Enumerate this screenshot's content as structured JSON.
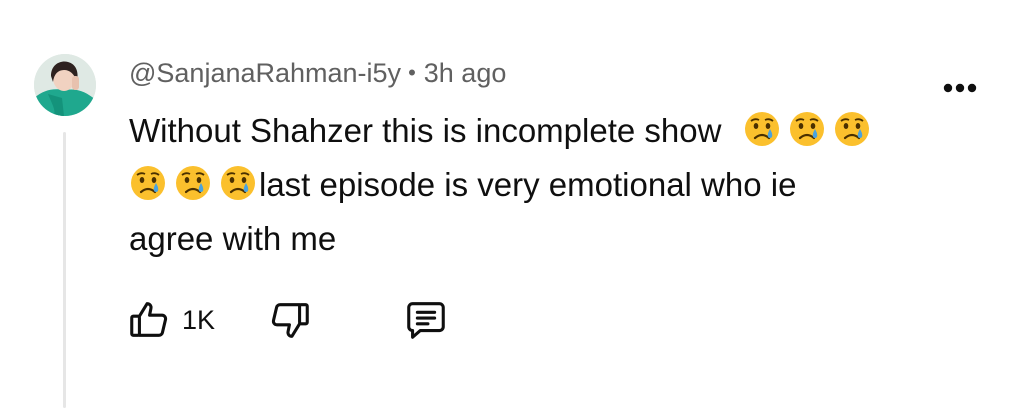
{
  "comment": {
    "author": "@SanjanaRahman-i5y",
    "separator": "•",
    "time": "3h ago",
    "text_line1": "Without Shahzer this is incomplete show",
    "text_line2": "last episode is very emotional who ie",
    "text_line3": "agree with me",
    "emoji": "crying-face",
    "like_count": "1K"
  },
  "icons": {
    "more": "more-vertical-dots-icon",
    "like": "thumbs-up-icon",
    "dislike": "thumbs-down-icon",
    "reply": "comment-icon"
  },
  "colors": {
    "text": "#0f0f0f",
    "meta": "#606060",
    "thread_line": "#e6e6e6",
    "emoji_face": "#fbc02d",
    "emoji_tear": "#4aa3df"
  }
}
